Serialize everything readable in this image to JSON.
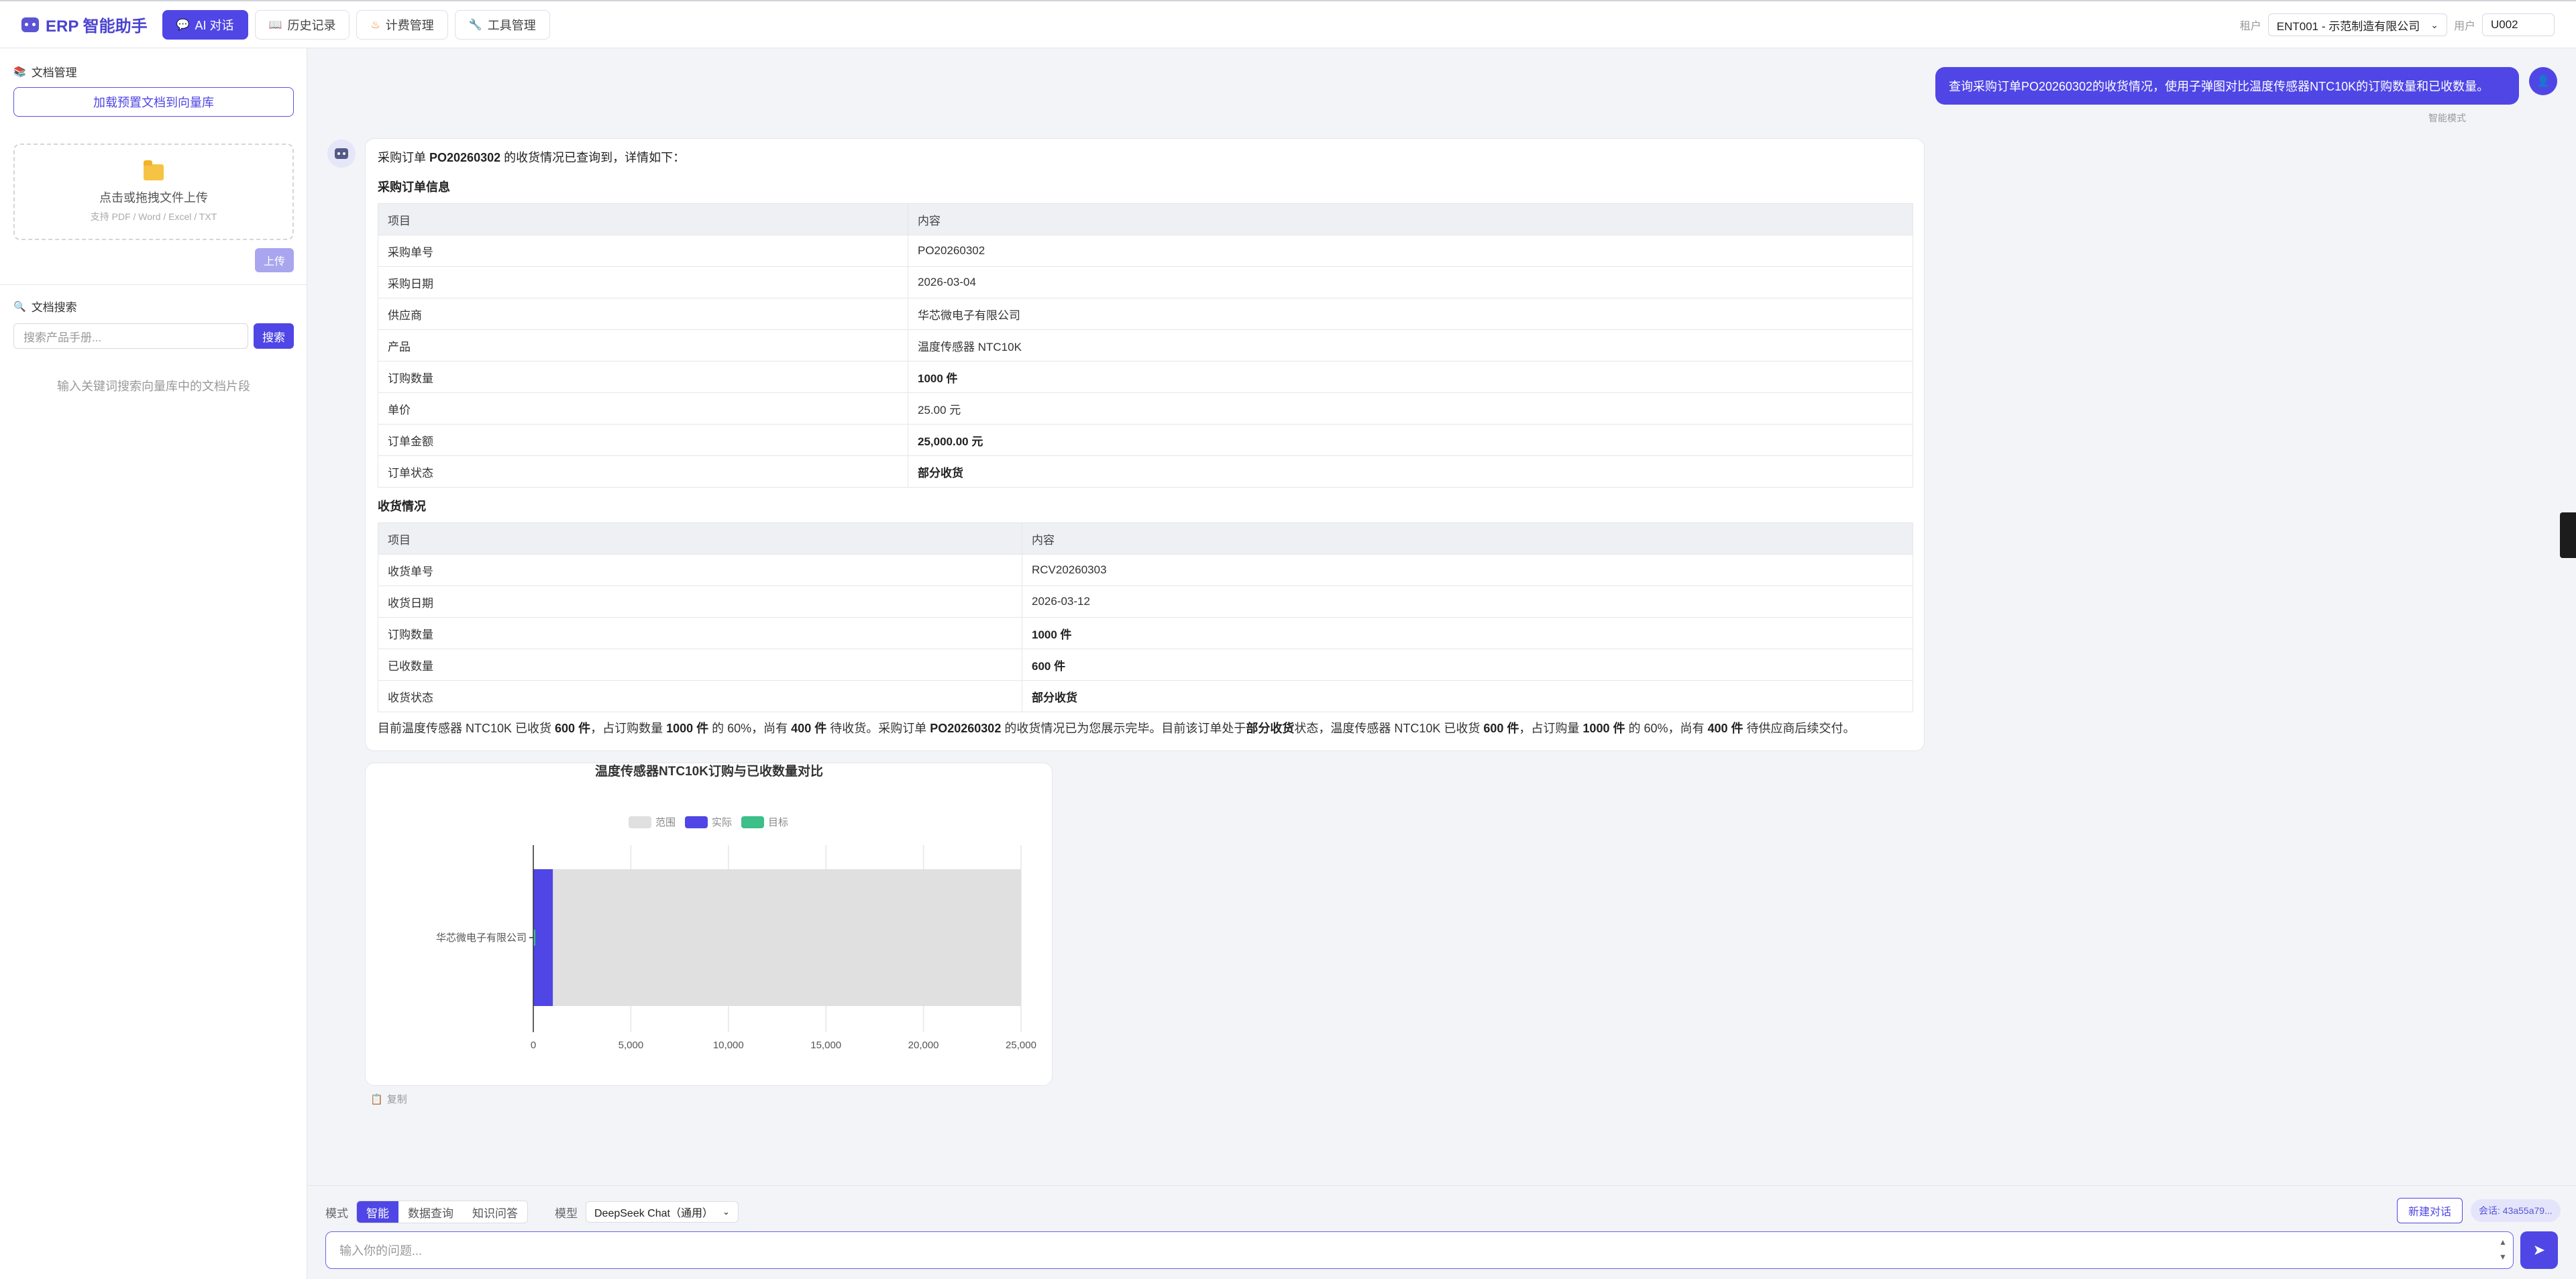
{
  "app": {
    "title": "ERP 智能助手"
  },
  "nav": {
    "tabs": [
      {
        "label": "AI 对话",
        "icon": "chat-icon"
      },
      {
        "label": "历史记录",
        "icon": "book-icon"
      },
      {
        "label": "计费管理",
        "icon": "fire-icon"
      },
      {
        "label": "工具管理",
        "icon": "wrench-icon"
      }
    ]
  },
  "header": {
    "tenant_label": "租户",
    "tenant_value": "ENT001 - 示范制造有限公司",
    "user_label": "用户",
    "user_value": "U002"
  },
  "sidebar": {
    "doc_title": "文档管理",
    "load_button": "加载预置文档到向量库",
    "drop_main": "点击或拖拽文件上传",
    "drop_sub": "支持 PDF / Word / Excel / TXT",
    "upload_button": "上传",
    "search_title": "文档搜索",
    "search_placeholder": "搜索产品手册...",
    "search_button": "搜索",
    "search_hint": "输入关键词搜索向量库中的文档片段"
  },
  "chat": {
    "user_message": "查询采购订单PO20260302的收货情况，使用子弹图对比温度传感器NTC10K的订购数量和已收数量。",
    "mode_tag": "智能模式",
    "intro_a": "采购订单 ",
    "intro_b": "PO20260302",
    "intro_c": " 的收货情况已查询到，详情如下：",
    "section1": "采购订单信息",
    "section2": "收货情况",
    "table1": {
      "headers": [
        "项目",
        "内容"
      ],
      "rows": [
        [
          "采购单号",
          "PO20260302"
        ],
        [
          "采购日期",
          "2026-03-04"
        ],
        [
          "供应商",
          "华芯微电子有限公司"
        ],
        [
          "产品",
          "温度传感器 NTC10K"
        ],
        [
          "订购数量",
          "1000 件"
        ],
        [
          "单价",
          "25.00 元"
        ],
        [
          "订单金额",
          "25,000.00 元"
        ],
        [
          "订单状态",
          "部分收货"
        ]
      ]
    },
    "table2": {
      "headers": [
        "项目",
        "内容"
      ],
      "rows": [
        [
          "收货单号",
          "RCV20260303"
        ],
        [
          "收货日期",
          "2026-03-12"
        ],
        [
          "订购数量",
          "1000 件"
        ],
        [
          "已收数量",
          "600 件"
        ],
        [
          "收货状态",
          "部分收货"
        ]
      ]
    },
    "summary": {
      "s1": "目前温度传感器 NTC10K 已收货 ",
      "b1": "600 件",
      "s2": "，占订购数量 ",
      "b2": "1000 件",
      "s3": " 的 60%，尚有 ",
      "b3": "400 件",
      "s4": " 待收货。采购订单 ",
      "b4": "PO20260302",
      "s5": " 的收货情况已为您展示完毕。目前该订单处于",
      "b5": "部分收货",
      "s6": "状态，温度传感器 NTC10K 已收货 ",
      "b6": "600 件",
      "s7": "，占订购量 ",
      "b7": "1000 件",
      "s8": " 的 60%，尚有 ",
      "b8": "400 件",
      "s9": " 待供应商后续交付。"
    },
    "copy_label": "复制"
  },
  "chart_data": {
    "type": "bar",
    "subtype": "bullet",
    "title": "温度传感器NTC10K订购与已收数量对比",
    "categories": [
      "华芯微电子有限公司"
    ],
    "series": [
      {
        "name": "范围",
        "values": [
          25000
        ],
        "color": "#e0e0e0"
      },
      {
        "name": "实际",
        "values": [
          1000
        ],
        "color": "#4f46e5"
      },
      {
        "name": "目标",
        "values": [
          0
        ],
        "color": "#3dbf8a"
      }
    ],
    "xlim": [
      0,
      25000
    ],
    "xticks": [
      0,
      5000,
      10000,
      15000,
      20000,
      25000
    ],
    "xtick_labels": [
      "0",
      "5,000",
      "10,000",
      "15,000",
      "20,000",
      "25,000"
    ],
    "orientation": "horizontal",
    "legend_position": "top-center",
    "grid": true
  },
  "bottom": {
    "mode_label": "模式",
    "modes": [
      "智能",
      "数据查询",
      "知识问答"
    ],
    "active_mode": "智能",
    "model_label": "模型",
    "model_value": "DeepSeek Chat（通用）",
    "new_chat": "新建对话",
    "session": "会话: 43a55a79...",
    "input_placeholder": "输入你的问题..."
  },
  "colors": {
    "accent": "#4f46e5",
    "target": "#3dbf8a",
    "range": "#e0e0e0"
  }
}
